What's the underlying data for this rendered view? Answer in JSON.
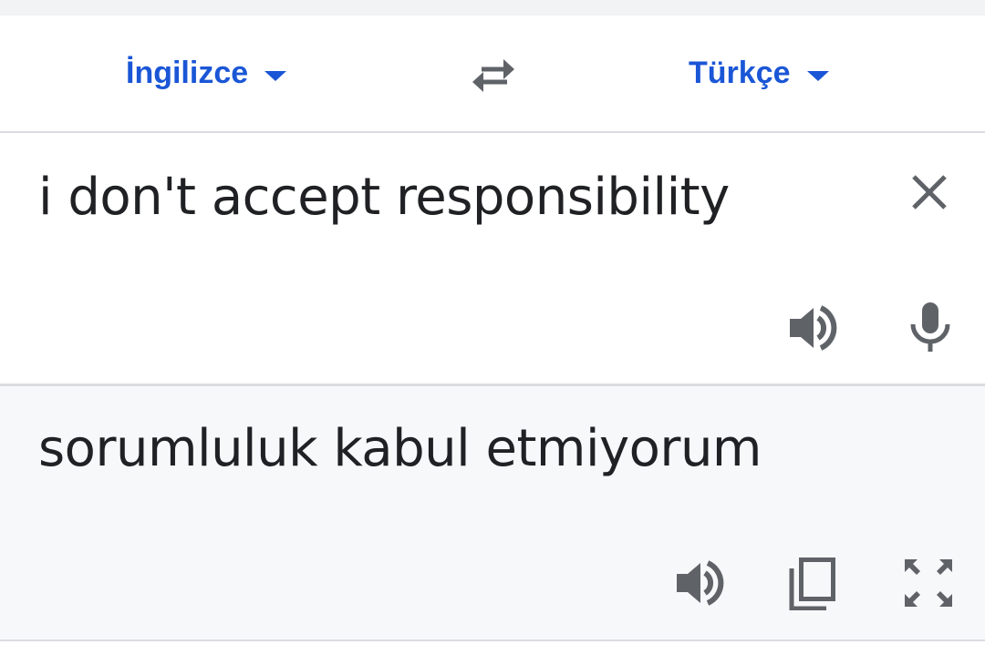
{
  "language_bar": {
    "source_language": "İngilizce",
    "target_language": "Türkçe",
    "accent_color": "#1a56d6",
    "swap_icon": "swap-arrows-icon"
  },
  "source": {
    "text": "i don't accept responsibility",
    "icons": [
      "close-icon",
      "speaker-icon",
      "microphone-icon"
    ]
  },
  "result": {
    "text": "sorumluluk kabul etmiyorum",
    "icons": [
      "speaker-icon",
      "copy-icon",
      "fullscreen-icon"
    ],
    "background_color": "#f7f8fa"
  }
}
